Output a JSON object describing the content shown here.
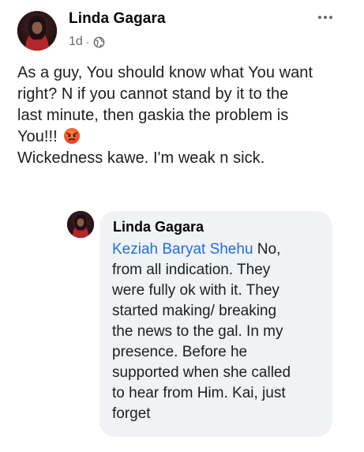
{
  "post": {
    "author": "Linda Gagara",
    "time": "1d",
    "separator": "·",
    "privacy_icon": "globe-icon",
    "more_icon": "more-options-icon",
    "lines": [
      "As a guy, You should know what You want",
      "right? N if you cannot stand by it to the",
      "last minute, then gaskia the problem is"
    ],
    "line4_text": "You!!!",
    "line4_emoji": "angry-face-emoji",
    "line5": "Wickedness kawe. I'm weak n sick."
  },
  "comment": {
    "author": "Linda Gagara",
    "mention": "Keziah Baryat Shehu",
    "line1_rest": " No,",
    "lines": [
      "from all indication. They",
      "were fully ok with it. They",
      "started making/ breaking",
      "the news to the gal. In my",
      "presence. Before he",
      "supported when she called",
      "to hear from Him. Kai, just",
      "forget"
    ]
  },
  "colors": {
    "name": "#050505",
    "meta": "#65676b",
    "link": "#216fdb",
    "bubble": "#f0f2f5",
    "emoji": "#f25a28"
  }
}
